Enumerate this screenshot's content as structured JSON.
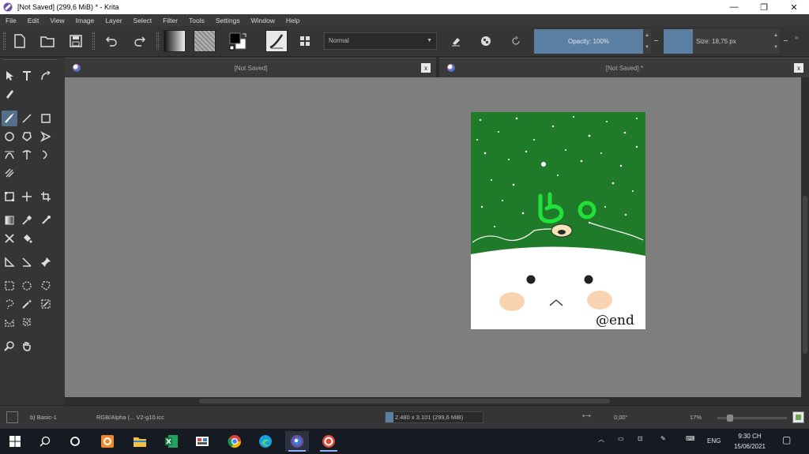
{
  "window": {
    "title": "[Not Saved]  (299,6 MiB)  * - Krita",
    "min_icon": "minimize-icon",
    "max_icon": "restore-icon",
    "close_icon": "close-icon"
  },
  "menu": [
    "File",
    "Edit",
    "View",
    "Image",
    "Layer",
    "Select",
    "Filter",
    "Tools",
    "Settings",
    "Window",
    "Help"
  ],
  "toolbar": {
    "blend_mode": "Normal",
    "opacity_label": "Opacity: 100%",
    "size_label": "Size: 18,75 px",
    "colors": {
      "fg": "#000000",
      "bg": "#ffffff",
      "accent": "#5a7fa3"
    }
  },
  "tabs": [
    {
      "name": "[Not Saved]",
      "close": "x"
    },
    {
      "name": "[Not Saved]  *",
      "close": "x"
    }
  ],
  "artwork": {
    "title_text": "Bo",
    "signature": "@end",
    "colors": {
      "green": "#1f7a2a",
      "lime": "#22e03a",
      "white": "#ffffff",
      "blush": "#f7c9a0"
    }
  },
  "status": {
    "brush_preset": "b) Basic-1",
    "color_profile": "RGB/Alpha (... V2-g10.icc",
    "dimensions": "2.480 x 3.101 (299,6 MiB)",
    "rotation": "0,00°",
    "zoom": "17%"
  },
  "taskbar": {
    "apps": [
      "start-icon",
      "search-icon",
      "cortana-icon",
      "mail-icon",
      "file-explorer-icon",
      "excel-icon",
      "snipping-tool-icon",
      "chrome-icon",
      "edge-icon",
      "krita-icon",
      "app-icon"
    ],
    "lang": "ENG",
    "time": "9:30 CH",
    "date": "15/06/2021"
  }
}
